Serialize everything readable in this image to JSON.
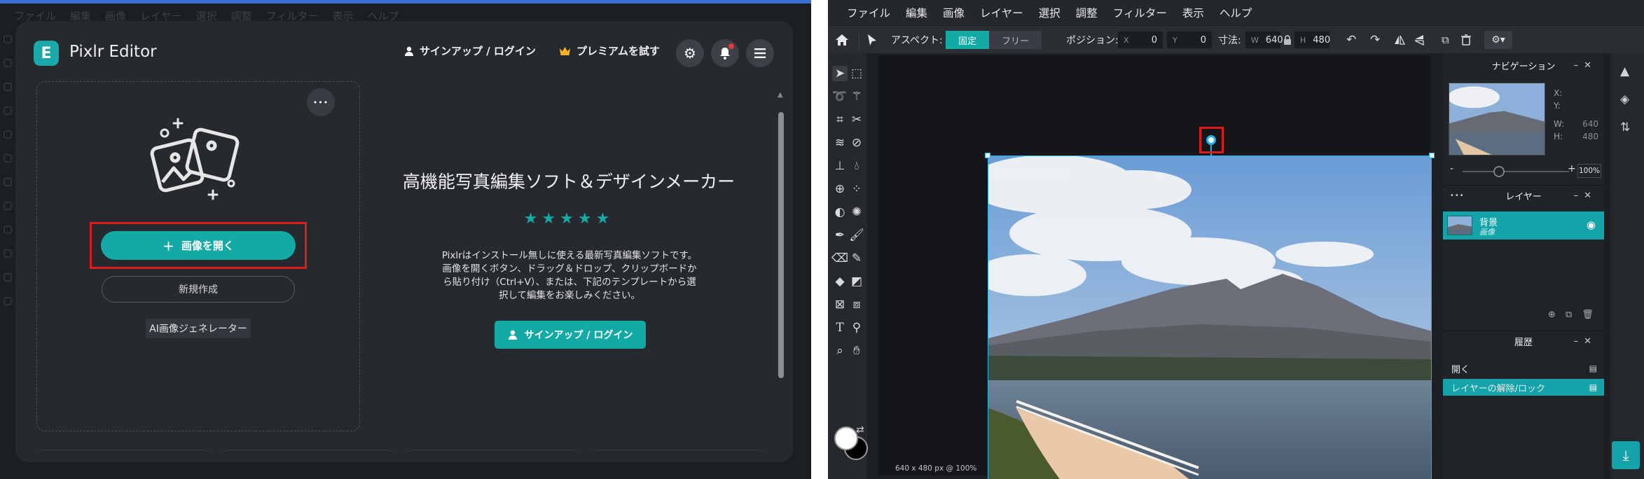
{
  "left": {
    "bg_menu": [
      "ファイル",
      "編集",
      "画像",
      "レイヤー",
      "選択",
      "調整",
      "フィルター",
      "表示",
      "ヘルプ"
    ],
    "app_title": "Pixlr Editor",
    "logo_letter": "E",
    "signup_top": "サインアップ / ログイン",
    "premium": "プレミアムを試す",
    "more": "•••",
    "open_image": "画像を開く",
    "new_create": "新規作成",
    "ai_generator": "AI画像ジェネレーター",
    "headline": "高機能写真編集ソフト＆デザインメーカー",
    "stars": "★★★★★",
    "description": "Pixlrはインストール無しに使える最新写真編集ソフトです。画像を開くボタン、ドラッグ＆ドロップ、クリップボードから貼り付け（Ctrl+V）、または、下記のテンプレートから選択して編集をお楽しみください。",
    "signup_main": "サインアップ / ログイン"
  },
  "right": {
    "menu": [
      "ファイル",
      "編集",
      "画像",
      "レイヤー",
      "選択",
      "調整",
      "フィルター",
      "表示",
      "ヘルプ"
    ],
    "toolbar": {
      "aspect_label": "アスペクト:",
      "fixed": "固定",
      "free": "フリー",
      "position_label": "ポジション:",
      "x_label": "X",
      "x_value": "0",
      "y_label": "Y",
      "y_value": "0",
      "size_label": "寸法:",
      "w_label": "W",
      "w_value": "640",
      "h_label": "H",
      "h_value": "480"
    },
    "status": "640 x 480 px @ 100%",
    "navigator": {
      "title": "ナビゲーション",
      "x": "X:",
      "y": "Y:",
      "w_label": "W:",
      "w_value": "640",
      "h_label": "H:",
      "h_value": "480",
      "zoom_minus": "-",
      "zoom_plus": "+",
      "zoom": "100%"
    },
    "layers": {
      "title": "レイヤー",
      "layer_name": "背景",
      "layer_sub": "画像"
    },
    "history": {
      "title": "履歴",
      "items": [
        "開く",
        "レイヤーの解除/ロック"
      ]
    },
    "colors": {
      "accent": "#13aaa6",
      "selection": "#1fb0e6",
      "highlight": "#e01a1a"
    }
  }
}
